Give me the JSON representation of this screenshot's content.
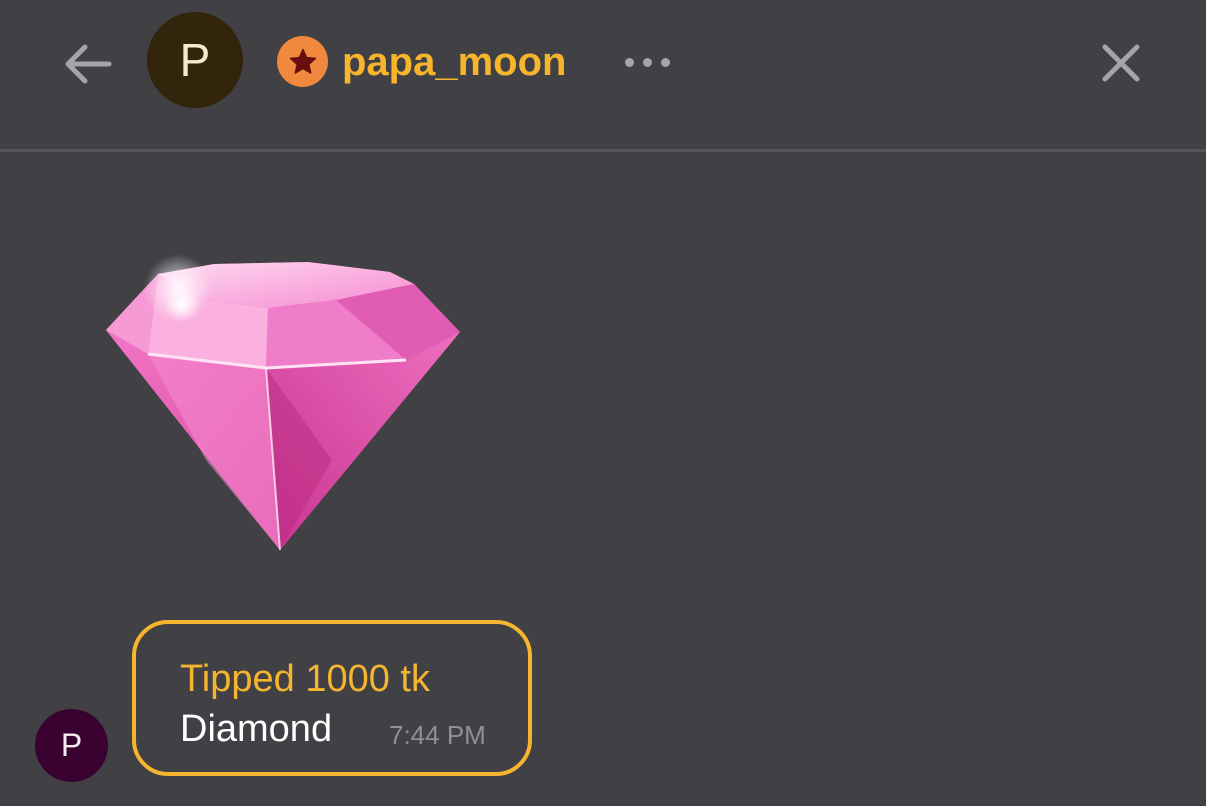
{
  "header": {
    "back_icon": "arrow-left-icon",
    "avatar_initial": "P",
    "avatar_color": "#33250b",
    "badge_icon": "star-icon",
    "badge_color": "#f0883e",
    "username": "papa_moon",
    "username_color": "#f7b52c",
    "more_icon": "more-horizontal-icon",
    "close_icon": "close-icon"
  },
  "message": {
    "gift_icon": "pink-diamond-icon",
    "avatar_initial": "P",
    "avatar_color": "#3a0231",
    "tip_text": "Tipped 1000 tk",
    "gift_name": "Diamond",
    "time": "7:44 PM",
    "accent_color": "#f6b52e"
  }
}
